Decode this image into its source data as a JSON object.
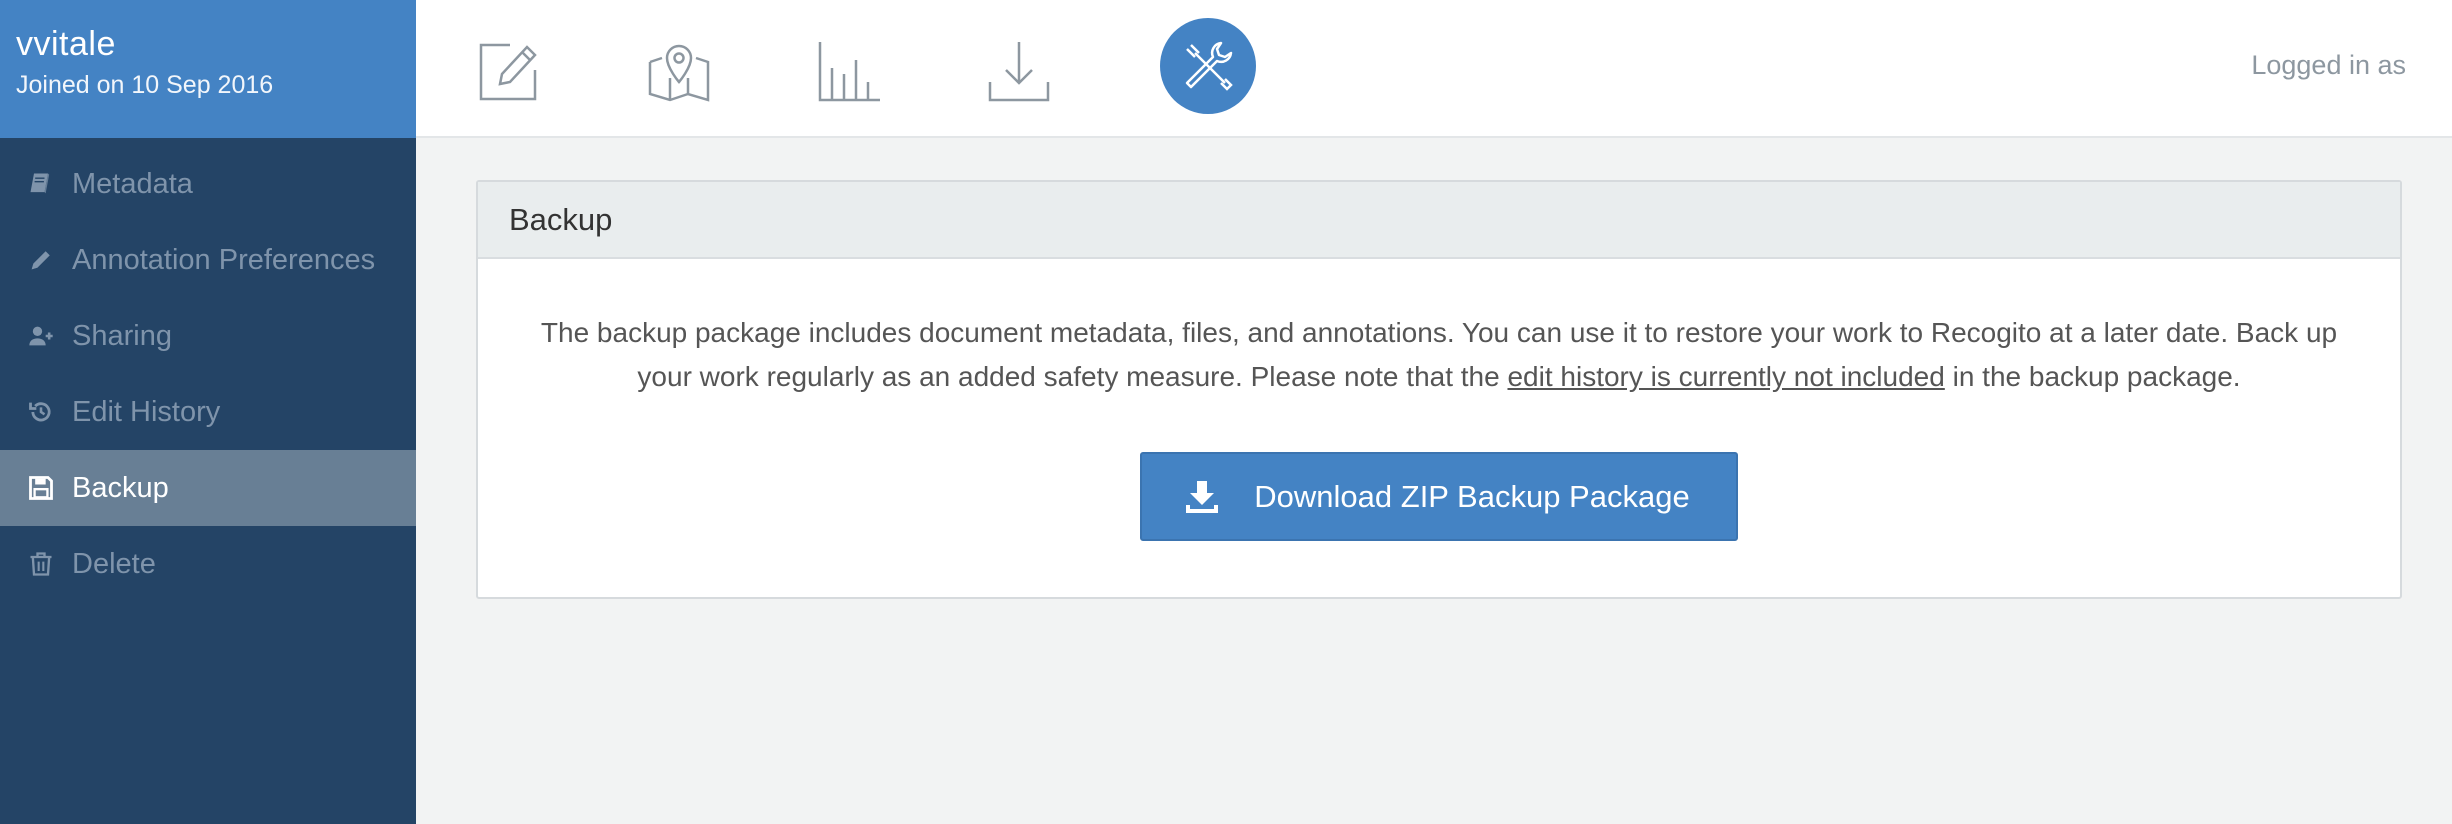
{
  "user": {
    "name": "vvitale",
    "joined": "Joined on 10 Sep 2016"
  },
  "sidebar": {
    "items": [
      {
        "label": "Metadata",
        "icon": "book-icon",
        "active": false
      },
      {
        "label": "Annotation Preferences",
        "icon": "pencil-icon",
        "active": false
      },
      {
        "label": "Sharing",
        "icon": "user-plus-icon",
        "active": false
      },
      {
        "label": "Edit History",
        "icon": "history-icon",
        "active": false
      },
      {
        "label": "Backup",
        "icon": "floppy-disk-icon",
        "active": true
      },
      {
        "label": "Delete",
        "icon": "trash-icon",
        "active": false
      }
    ]
  },
  "toolbar": {
    "tools": [
      {
        "icon": "edit-icon",
        "active": false
      },
      {
        "icon": "map-icon",
        "active": false
      },
      {
        "icon": "bar-chart-icon",
        "active": false
      },
      {
        "icon": "download-icon",
        "active": false
      },
      {
        "icon": "tools-icon",
        "active": true
      }
    ],
    "logged_in_label": "Logged in as"
  },
  "panel": {
    "title": "Backup",
    "text_before": "The backup package includes document metadata, files, and annotations. You can use it to restore your work to Recogito at a later date. Back up your work regularly as an added safety measure. Please note that the ",
    "text_highlight": "edit history is currently not included",
    "text_after": " in the backup package.",
    "button_label": "Download ZIP Backup Package"
  },
  "colors": {
    "sidebar_bg": "#244466",
    "header_blue": "#4483c4",
    "active_item_bg": "#687f95",
    "inactive_text": "#7f94ab"
  }
}
